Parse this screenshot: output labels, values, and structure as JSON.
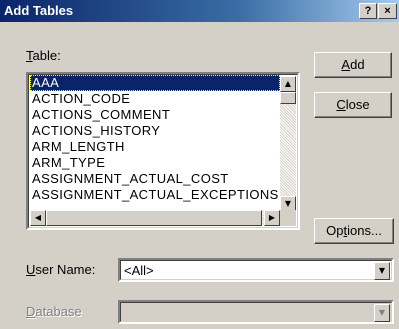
{
  "window": {
    "title": "Add Tables",
    "help_button": "?",
    "close_button": "×"
  },
  "table_label": {
    "accel": "T",
    "rest": "able:"
  },
  "tables": [
    "AAA",
    "ACTION_CODE",
    "ACTIONS_COMMENT",
    "ACTIONS_HISTORY",
    "ARM_LENGTH",
    "ARM_TYPE",
    "ASSIGNMENT_ACTUAL_COST",
    "ASSIGNMENT_ACTUAL_EXCEPTIONS"
  ],
  "selected_table": "AAA",
  "buttons": {
    "add": {
      "accel": "A",
      "rest": "dd"
    },
    "close": {
      "accel": "C",
      "rest": "lose"
    },
    "options": {
      "pre": "Op",
      "accel": "t",
      "rest": "ions..."
    }
  },
  "user_name": {
    "label_accel": "U",
    "label_rest": "ser Name:",
    "value": "<All>"
  },
  "database": {
    "label_accel": "D",
    "label_rest": "atabase",
    "value": ""
  },
  "icons": {
    "scroll_up": "▲",
    "scroll_down": "▼",
    "scroll_left": "◀",
    "scroll_right": "▶",
    "dropdown": "▼"
  },
  "colors": {
    "title_start": "#0a246a",
    "title_end": "#a6caf0",
    "selection": "#0a246a",
    "face": "#d4d0c8"
  }
}
